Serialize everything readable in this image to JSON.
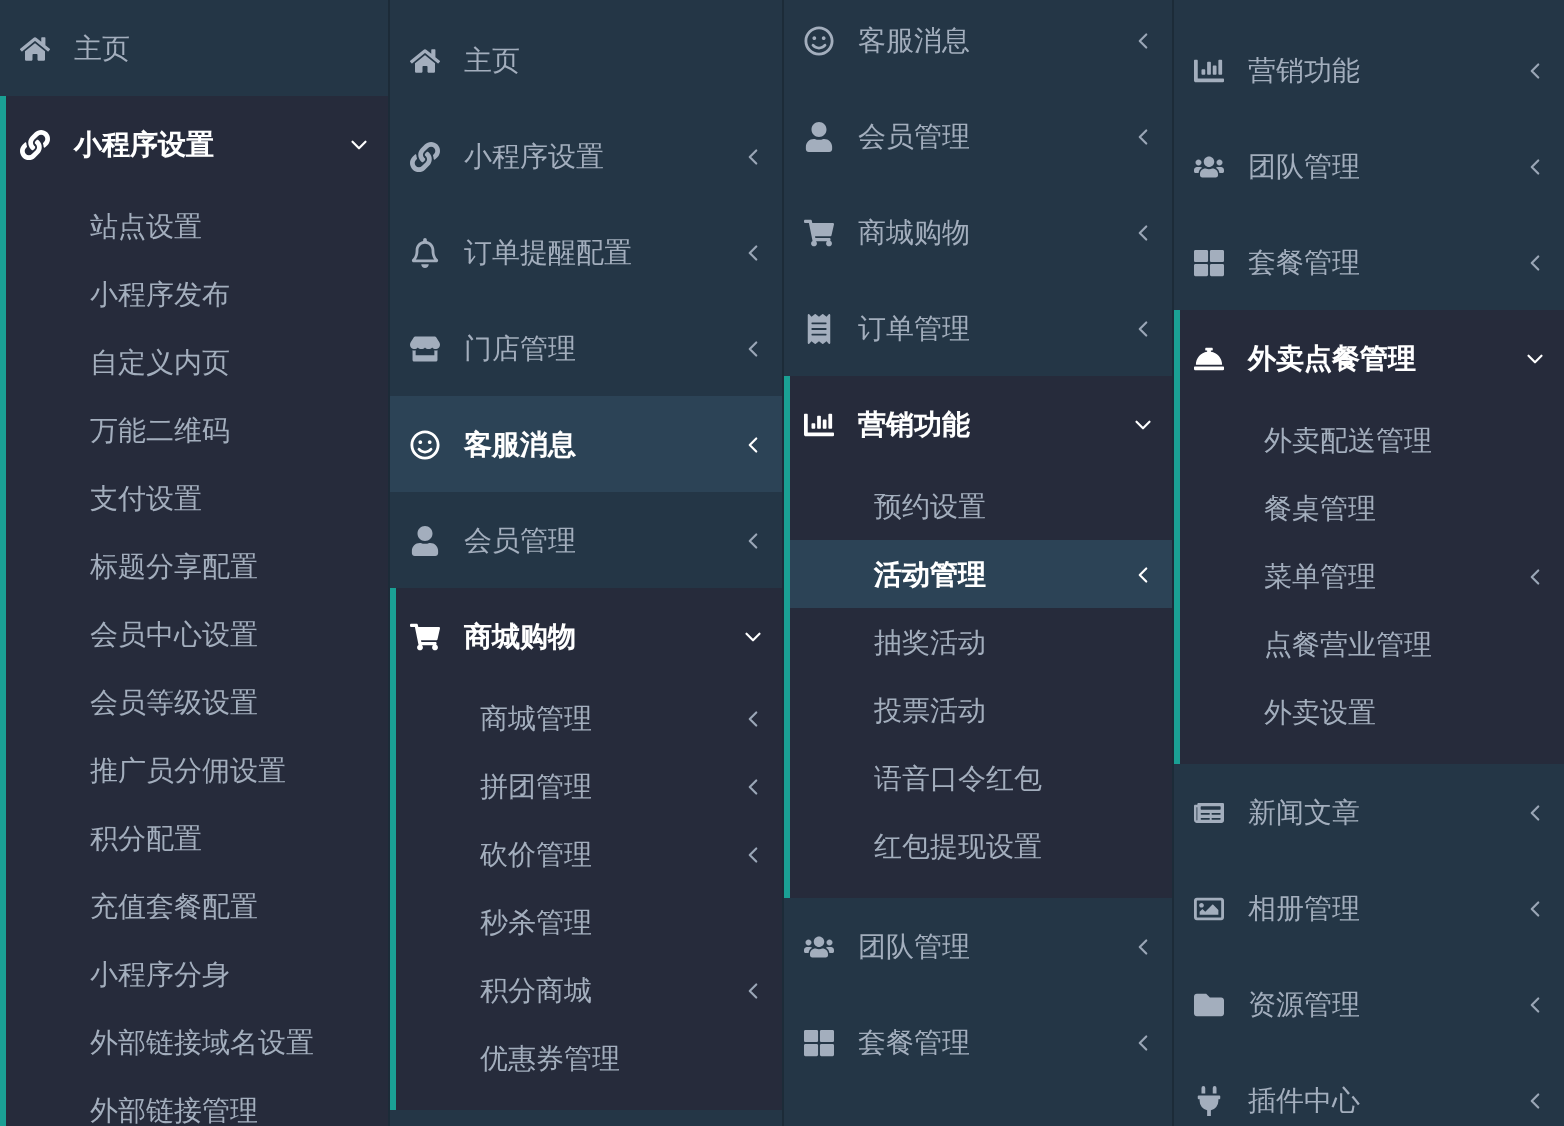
{
  "panels": [
    {
      "items": [
        {
          "label": "主页",
          "expandable": false,
          "expanded": false,
          "selected": false
        },
        {
          "label": "小程序设置",
          "expandable": true,
          "expanded": true,
          "selected": false,
          "children": [
            {
              "label": "站点设置",
              "expandable": false,
              "selected": false
            },
            {
              "label": "小程序发布",
              "expandable": false,
              "selected": false
            },
            {
              "label": "自定义内页",
              "expandable": false,
              "selected": false
            },
            {
              "label": "万能二维码",
              "expandable": false,
              "selected": false
            },
            {
              "label": "支付设置",
              "expandable": false,
              "selected": false
            },
            {
              "label": "标题分享配置",
              "expandable": false,
              "selected": false
            },
            {
              "label": "会员中心设置",
              "expandable": false,
              "selected": false
            },
            {
              "label": "会员等级设置",
              "expandable": false,
              "selected": false
            },
            {
              "label": "推广员分佣设置",
              "expandable": false,
              "selected": false
            },
            {
              "label": "积分配置",
              "expandable": false,
              "selected": false
            },
            {
              "label": "充值套餐配置",
              "expandable": false,
              "selected": false
            },
            {
              "label": "小程序分身",
              "expandable": false,
              "selected": false
            },
            {
              "label": "外部链接域名设置",
              "expandable": false,
              "selected": false
            },
            {
              "label": "外部链接管理",
              "expandable": false,
              "selected": false
            }
          ]
        }
      ]
    },
    {
      "items": [
        {
          "label": "主页",
          "expandable": false,
          "expanded": false,
          "selected": false
        },
        {
          "label": "小程序设置",
          "expandable": true,
          "expanded": false,
          "selected": false
        },
        {
          "label": "订单提醒配置",
          "expandable": true,
          "expanded": false,
          "selected": false
        },
        {
          "label": "门店管理",
          "expandable": true,
          "expanded": false,
          "selected": false
        },
        {
          "label": "客服消息",
          "expandable": true,
          "expanded": false,
          "selected": true
        },
        {
          "label": "会员管理",
          "expandable": true,
          "expanded": false,
          "selected": false
        },
        {
          "label": "商城购物",
          "expandable": true,
          "expanded": true,
          "selected": false,
          "children": [
            {
              "label": "商城管理",
              "expandable": true,
              "selected": false
            },
            {
              "label": "拼团管理",
              "expandable": true,
              "selected": false
            },
            {
              "label": "砍价管理",
              "expandable": true,
              "selected": false
            },
            {
              "label": "秒杀管理",
              "expandable": false,
              "selected": false
            },
            {
              "label": "积分商城",
              "expandable": true,
              "selected": false
            },
            {
              "label": "优惠券管理",
              "expandable": false,
              "selected": false
            }
          ]
        }
      ]
    },
    {
      "items": [
        {
          "label": "客服消息",
          "expandable": true,
          "expanded": false,
          "selected": false
        },
        {
          "label": "会员管理",
          "expandable": true,
          "expanded": false,
          "selected": false
        },
        {
          "label": "商城购物",
          "expandable": true,
          "expanded": false,
          "selected": false
        },
        {
          "label": "订单管理",
          "expandable": true,
          "expanded": false,
          "selected": false
        },
        {
          "label": "营销功能",
          "expandable": true,
          "expanded": true,
          "selected": false,
          "children": [
            {
              "label": "预约设置",
              "expandable": false,
              "selected": false
            },
            {
              "label": "活动管理",
              "expandable": true,
              "selected": true
            },
            {
              "label": "抽奖活动",
              "expandable": false,
              "selected": false
            },
            {
              "label": "投票活动",
              "expandable": false,
              "selected": false
            },
            {
              "label": "语音口令红包",
              "expandable": false,
              "selected": false
            },
            {
              "label": "红包提现设置",
              "expandable": false,
              "selected": false
            }
          ]
        },
        {
          "label": "团队管理",
          "expandable": true,
          "expanded": false,
          "selected": false
        },
        {
          "label": "套餐管理",
          "expandable": true,
          "expanded": false,
          "selected": false
        }
      ]
    },
    {
      "items": [
        {
          "label": "营销功能",
          "expandable": true,
          "expanded": false,
          "selected": false
        },
        {
          "label": "团队管理",
          "expandable": true,
          "expanded": false,
          "selected": false
        },
        {
          "label": "套餐管理",
          "expandable": true,
          "expanded": false,
          "selected": false
        },
        {
          "label": "外卖点餐管理",
          "expandable": true,
          "expanded": true,
          "selected": false,
          "children": [
            {
              "label": "外卖配送管理",
              "expandable": false,
              "selected": false
            },
            {
              "label": "餐桌管理",
              "expandable": false,
              "selected": false
            },
            {
              "label": "菜单管理",
              "expandable": true,
              "selected": false
            },
            {
              "label": "点餐营业管理",
              "expandable": false,
              "selected": false
            },
            {
              "label": "外卖设置",
              "expandable": false,
              "selected": false
            }
          ]
        },
        {
          "label": "新闻文章",
          "expandable": true,
          "expanded": false,
          "selected": false
        },
        {
          "label": "相册管理",
          "expandable": true,
          "expanded": false,
          "selected": false
        },
        {
          "label": "资源管理",
          "expandable": true,
          "expanded": false,
          "selected": false
        },
        {
          "label": "插件中心",
          "expandable": true,
          "expanded": false,
          "selected": false
        }
      ]
    }
  ]
}
